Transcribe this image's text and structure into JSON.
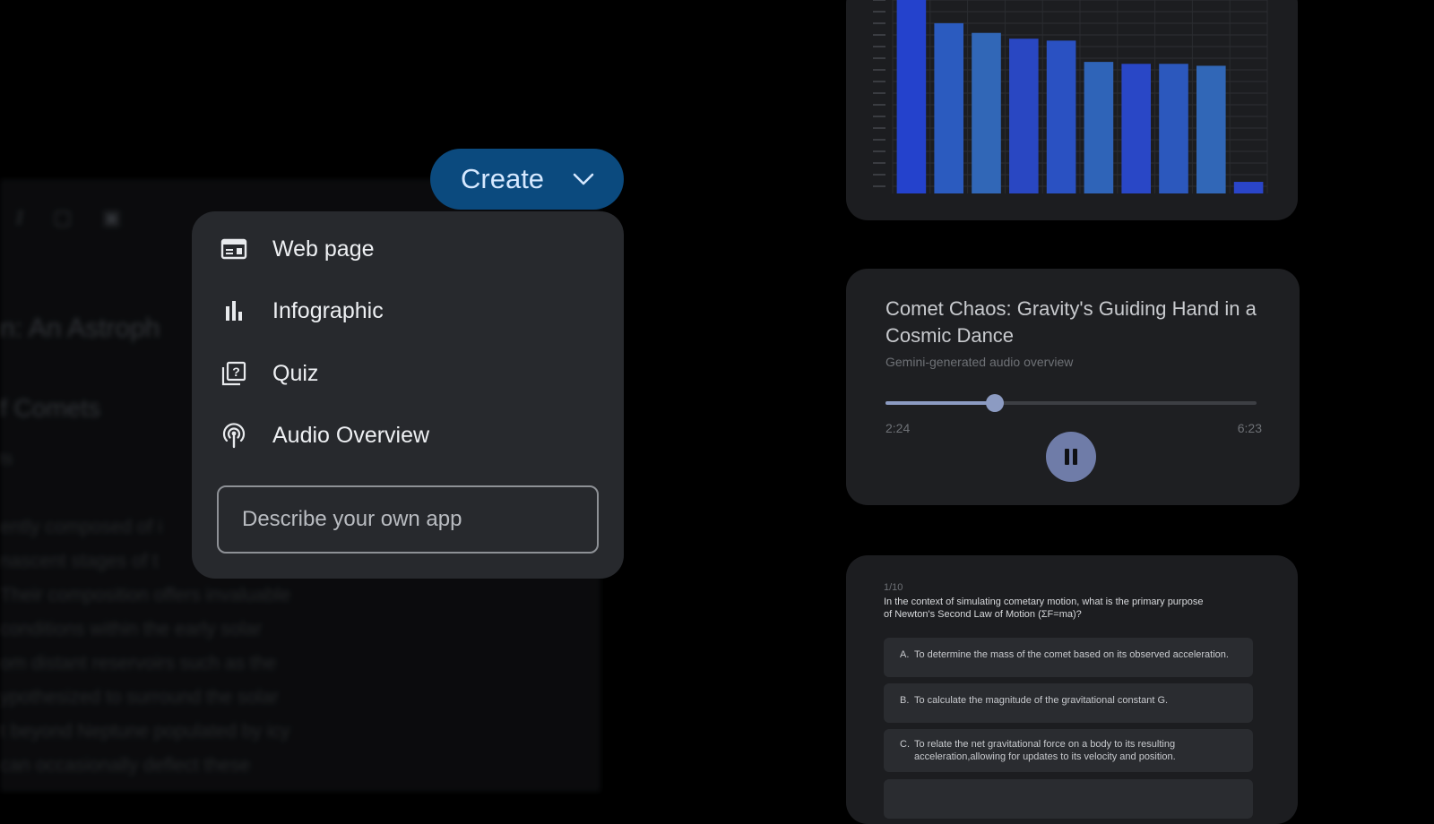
{
  "background_doc": {
    "toolbar_icons": [
      "italic-icon",
      "image-icon",
      "link-icon"
    ],
    "title": "n: An Astroph",
    "subtitle": "f Comets",
    "small": "ts",
    "paragraph_lines": [
      "ently composed of i",
      "nascent stages of t",
      "Their composition offers invaluable",
      "conditions within the early solar",
      "om distant reservoirs such as the",
      "ypothesized to surround the solar",
      "t beyond Neptune populated by icy",
      "can occasionally deflect these"
    ]
  },
  "create_button": {
    "label": "Create",
    "icon": "chevron-down-icon",
    "color": "#0b4a7e"
  },
  "menu": {
    "items": [
      {
        "label": "Web page",
        "icon": "web-page-icon"
      },
      {
        "label": "Infographic",
        "icon": "bar-chart-icon"
      },
      {
        "label": "Quiz",
        "icon": "quiz-icon"
      },
      {
        "label": "Audio Overview",
        "icon": "podcast-icon"
      }
    ],
    "prompt_placeholder": "Describe your own app"
  },
  "chart_data": {
    "type": "bar",
    "values": [
      100,
      88,
      83,
      80,
      79,
      68,
      67,
      67,
      66,
      6
    ],
    "colors": [
      "#2442cc",
      "#2b5bbf",
      "#3167b7",
      "#2947c2",
      "#2a51c2",
      "#2f64b8",
      "#2947c6",
      "#2c58bd",
      "#3167b7",
      "#2a45c8"
    ],
    "ylim": [
      0,
      100
    ],
    "grid": true
  },
  "audio": {
    "title": "Comet Chaos: Gravity's Guiding Hand in a Cosmic Dance",
    "subtitle": "Gemini-generated audio overview",
    "current": "2:24",
    "duration": "6:23",
    "progress": 0.294,
    "accent": "#8c9bc2"
  },
  "quiz": {
    "count": "1/10",
    "question": "In the context of simulating cometary motion, what is the primary purpose of Newton's Second Law of Motion (ΣF=ma)?",
    "options": [
      {
        "letter": "A.",
        "text": "To determine the mass of the comet based on its observed acceleration."
      },
      {
        "letter": "B.",
        "text": "To calculate the magnitude of the gravitational constant G."
      },
      {
        "letter": "C.",
        "text": "To relate the net gravitational force on a body to its resulting acceleration,allowing for updates to its velocity and position."
      }
    ]
  }
}
